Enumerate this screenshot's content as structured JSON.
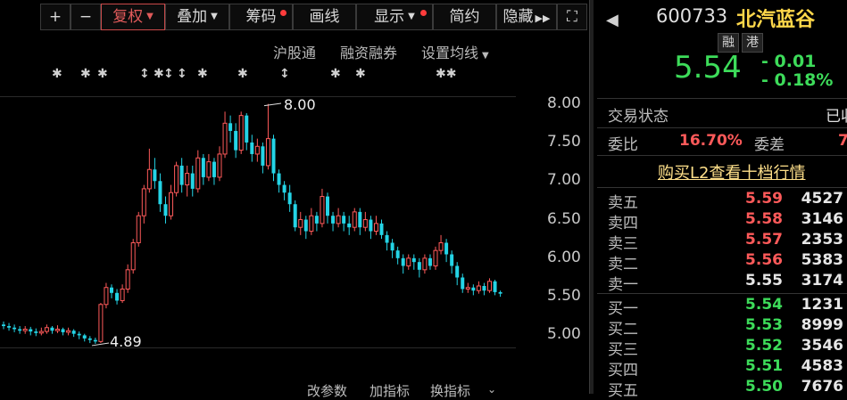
{
  "toolbar": {
    "plus": "+",
    "minus": "−",
    "fuquan": "复权",
    "diejia": "叠加",
    "chouma": "筹码",
    "huaxian": "画线",
    "xianshi": "显示",
    "jianyue": "简约",
    "yincang": "隐藏",
    "fullscreen": "⛶"
  },
  "sublinks": {
    "hugutong": "沪股通",
    "rongzi": "融资融券",
    "junxian": "设置均线"
  },
  "annotations": {
    "high": "8.00",
    "low": "4.89"
  },
  "bottom_tabs": [
    "改参数",
    "加指标",
    "换指标"
  ],
  "stock": {
    "code": "600733",
    "name": "北汽蓝谷",
    "badges": [
      "融",
      "港"
    ],
    "price": "5.54",
    "change": "- 0.01",
    "change_pct": "- 0.18%",
    "nav_icon": "triangle-left-icon"
  },
  "info": {
    "status_label": "交易状态",
    "status_value": "已收",
    "weibi_label": "委比",
    "weibi_value": "16.70%",
    "weicha_label": "委差",
    "weicha_value": "7",
    "l2_link": "购买L2查看十档行情"
  },
  "asks": [
    {
      "label": "卖五",
      "price": "5.59",
      "vol": "4527",
      "color": "red"
    },
    {
      "label": "卖四",
      "price": "5.58",
      "vol": "3146",
      "color": "red"
    },
    {
      "label": "卖三",
      "price": "5.57",
      "vol": "2353",
      "color": "red"
    },
    {
      "label": "卖二",
      "price": "5.56",
      "vol": "5383",
      "color": "red"
    },
    {
      "label": "卖一",
      "price": "5.55",
      "vol": "3174",
      "color": "white"
    }
  ],
  "bids": [
    {
      "label": "买一",
      "price": "5.54",
      "vol": "1231",
      "color": "green"
    },
    {
      "label": "买二",
      "price": "5.53",
      "vol": "8999",
      "color": "green"
    },
    {
      "label": "买三",
      "price": "5.52",
      "vol": "3546",
      "color": "green"
    },
    {
      "label": "买四",
      "price": "5.51",
      "vol": "4583",
      "color": "green"
    },
    {
      "label": "买五",
      "price": "5.50",
      "vol": "7676",
      "color": "green"
    }
  ],
  "colors": {
    "up": "#ff5a5a",
    "down": "#24d4e6",
    "green": "#3ddc5a",
    "accent_red": "#e05a5a"
  },
  "chart_data": {
    "type": "candlestick",
    "y_ticks": [
      "8.00",
      "7.50",
      "7.00",
      "6.50",
      "6.00",
      "5.50",
      "5.00"
    ],
    "ylim": [
      4.82,
      8.1
    ],
    "candles": [
      [
        5.14,
        5.12,
        5.18,
        5.08
      ],
      [
        5.12,
        5.1,
        5.16,
        5.06
      ],
      [
        5.1,
        5.08,
        5.14,
        5.04
      ],
      [
        5.08,
        5.06,
        5.12,
        5.02
      ],
      [
        5.06,
        5.08,
        5.12,
        5.02
      ],
      [
        5.08,
        5.05,
        5.11,
        5.0
      ],
      [
        5.05,
        5.03,
        5.09,
        4.99
      ],
      [
        5.03,
        5.05,
        5.1,
        5.0
      ],
      [
        5.05,
        5.1,
        5.14,
        5.02
      ],
      [
        5.1,
        5.06,
        5.12,
        5.02
      ],
      [
        5.06,
        5.08,
        5.13,
        5.03
      ],
      [
        5.08,
        5.04,
        5.1,
        5.0
      ],
      [
        5.04,
        5.06,
        5.1,
        5.0
      ],
      [
        5.06,
        5.02,
        5.08,
        4.98
      ],
      [
        5.02,
        5.0,
        5.05,
        4.95
      ],
      [
        5.0,
        4.96,
        5.02,
        4.92
      ],
      [
        4.96,
        4.94,
        4.99,
        4.9
      ],
      [
        4.94,
        4.92,
        4.97,
        4.89
      ],
      [
        4.92,
        5.4,
        5.42,
        4.9
      ],
      [
        5.4,
        5.62,
        5.68,
        5.35
      ],
      [
        5.62,
        5.55,
        5.66,
        5.48
      ],
      [
        5.55,
        5.45,
        5.6,
        5.4
      ],
      [
        5.45,
        5.6,
        5.66,
        5.42
      ],
      [
        5.6,
        5.85,
        5.92,
        5.55
      ],
      [
        5.85,
        6.2,
        6.25,
        5.8
      ],
      [
        6.2,
        6.55,
        6.6,
        6.15
      ],
      [
        6.55,
        6.9,
        6.95,
        6.45
      ],
      [
        6.9,
        7.15,
        7.42,
        6.85
      ],
      [
        7.15,
        7.0,
        7.3,
        6.9
      ],
      [
        7.0,
        6.7,
        7.1,
        6.6
      ],
      [
        6.7,
        6.55,
        6.8,
        6.45
      ],
      [
        6.55,
        6.85,
        6.95,
        6.5
      ],
      [
        6.85,
        7.2,
        7.25,
        6.8
      ],
      [
        7.2,
        6.95,
        7.3,
        6.85
      ],
      [
        6.95,
        7.1,
        7.2,
        6.8
      ],
      [
        7.1,
        6.9,
        7.2,
        6.8
      ],
      [
        6.9,
        7.3,
        7.4,
        6.85
      ],
      [
        7.3,
        7.05,
        7.35,
        6.95
      ],
      [
        7.05,
        7.25,
        7.35,
        7.0
      ],
      [
        7.25,
        7.05,
        7.3,
        6.95
      ],
      [
        7.05,
        7.35,
        7.45,
        7.0
      ],
      [
        7.35,
        7.75,
        7.9,
        7.3
      ],
      [
        7.75,
        7.65,
        7.85,
        7.5
      ],
      [
        7.65,
        7.4,
        7.75,
        7.3
      ],
      [
        7.4,
        7.85,
        7.9,
        7.35
      ],
      [
        7.85,
        7.5,
        7.88,
        7.4
      ],
      [
        7.5,
        7.35,
        7.6,
        7.25
      ],
      [
        7.35,
        7.45,
        7.55,
        7.25
      ],
      [
        7.45,
        7.2,
        7.5,
        7.1
      ],
      [
        7.2,
        7.55,
        8.0,
        7.15
      ],
      [
        7.55,
        7.1,
        7.6,
        7.0
      ],
      [
        7.1,
        6.95,
        7.15,
        6.85
      ],
      [
        6.95,
        6.85,
        7.0,
        6.75
      ],
      [
        6.85,
        6.7,
        6.95,
        6.6
      ],
      [
        6.7,
        6.4,
        6.75,
        6.35
      ],
      [
        6.4,
        6.5,
        6.6,
        6.3
      ],
      [
        6.5,
        6.35,
        6.55,
        6.25
      ],
      [
        6.35,
        6.55,
        6.65,
        6.3
      ],
      [
        6.55,
        6.45,
        6.6,
        6.35
      ],
      [
        6.45,
        6.8,
        6.9,
        6.4
      ],
      [
        6.8,
        6.55,
        6.85,
        6.45
      ],
      [
        6.55,
        6.45,
        6.6,
        6.35
      ],
      [
        6.45,
        6.55,
        6.65,
        6.4
      ],
      [
        6.55,
        6.45,
        6.6,
        6.35
      ],
      [
        6.45,
        6.4,
        6.55,
        6.3
      ],
      [
        6.4,
        6.6,
        6.65,
        6.35
      ],
      [
        6.6,
        6.4,
        6.65,
        6.3
      ],
      [
        6.4,
        6.5,
        6.6,
        6.35
      ],
      [
        6.5,
        6.35,
        6.55,
        6.25
      ],
      [
        6.35,
        6.45,
        6.55,
        6.3
      ],
      [
        6.45,
        6.3,
        6.5,
        6.25
      ],
      [
        6.3,
        6.2,
        6.35,
        6.1
      ],
      [
        6.2,
        6.1,
        6.25,
        6.0
      ],
      [
        6.1,
        6.0,
        6.15,
        5.92
      ],
      [
        6.0,
        5.9,
        6.05,
        5.8
      ],
      [
        5.9,
        6.0,
        6.05,
        5.85
      ],
      [
        6.0,
        5.95,
        6.05,
        5.85
      ],
      [
        5.95,
        5.85,
        6.0,
        5.75
      ],
      [
        5.85,
        6.0,
        6.05,
        5.8
      ],
      [
        6.0,
        5.9,
        6.05,
        5.85
      ],
      [
        5.9,
        6.1,
        6.15,
        5.85
      ],
      [
        6.1,
        6.2,
        6.3,
        6.05
      ],
      [
        6.2,
        6.05,
        6.25,
        5.95
      ],
      [
        6.05,
        5.9,
        6.1,
        5.8
      ],
      [
        5.9,
        5.75,
        5.95,
        5.65
      ],
      [
        5.75,
        5.6,
        5.8,
        5.55
      ],
      [
        5.6,
        5.62,
        5.68,
        5.55
      ],
      [
        5.62,
        5.58,
        5.66,
        5.52
      ],
      [
        5.58,
        5.64,
        5.7,
        5.54
      ],
      [
        5.64,
        5.58,
        5.68,
        5.52
      ],
      [
        5.58,
        5.7,
        5.74,
        5.55
      ],
      [
        5.7,
        5.56,
        5.72,
        5.52
      ],
      [
        5.56,
        5.54,
        5.58,
        5.5
      ]
    ]
  }
}
